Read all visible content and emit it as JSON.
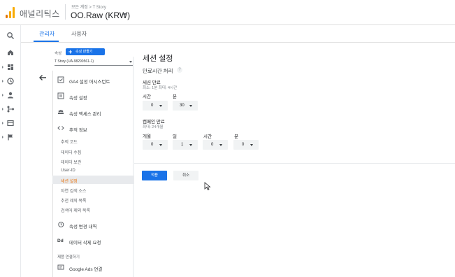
{
  "app": {
    "title": "애널리틱스",
    "breadcrumb": "모든 계정 > T Story",
    "account": "OO.Raw (KRW)"
  },
  "rail": {
    "icons": [
      "search-icon",
      "home-icon",
      "dashboard-icon",
      "clock-icon",
      "person-icon",
      "branch-icon",
      "panel-icon",
      "flag-icon"
    ]
  },
  "tabs": {
    "admin": "관리자",
    "user": "사용자"
  },
  "property": {
    "label": "속성",
    "create_button": "속성 만들기",
    "selected": "T Story (UA-98290561-1)",
    "menu": [
      {
        "label": "GA4 설정 어시스턴트",
        "icon": "checklist-icon"
      },
      {
        "label": "속성 설정",
        "icon": "settings-box-icon"
      },
      {
        "label": "속성 액세스 관리",
        "icon": "people-icon"
      },
      {
        "label": "추적 정보",
        "icon": "code-icon"
      }
    ],
    "tracking_sub": [
      "추적 코드",
      "데이터 수집",
      "데이터 보관",
      "User-ID",
      "세션 설정",
      "자연 검색 소스",
      "추천 제외 목록",
      "검색어 제외 목록"
    ],
    "menu_after": [
      {
        "label": "속성 변경 내역",
        "icon": "history-icon"
      },
      {
        "label": "데이터 삭제 요청",
        "icon": "dd-icon",
        "glyph": "Dd"
      }
    ],
    "section_product_links": "제품 연결하기",
    "google_ads": "Google Ads 연결"
  },
  "main": {
    "title": "세션 설정",
    "subtitle": "만료시간 처리",
    "session_timeout": {
      "title": "세션 만료",
      "hint": "최소: 1분 최대: 4시간",
      "hours_label": "시간",
      "hours_value": "0",
      "minutes_label": "분",
      "minutes_value": "30"
    },
    "campaign_timeout": {
      "title": "캠페인 만료",
      "hint": "최대: 24개월",
      "months_label": "개월",
      "months_value": "0",
      "days_label": "일",
      "days_value": "1",
      "hours_label": "시간",
      "hours_value": "0",
      "minutes_label": "분",
      "minutes_value": "0"
    },
    "apply": "적용",
    "cancel": "취소"
  },
  "colors": {
    "accent": "#1a73e8",
    "active_sub": "#e8710a",
    "logo_orange": "#f9ab00"
  }
}
